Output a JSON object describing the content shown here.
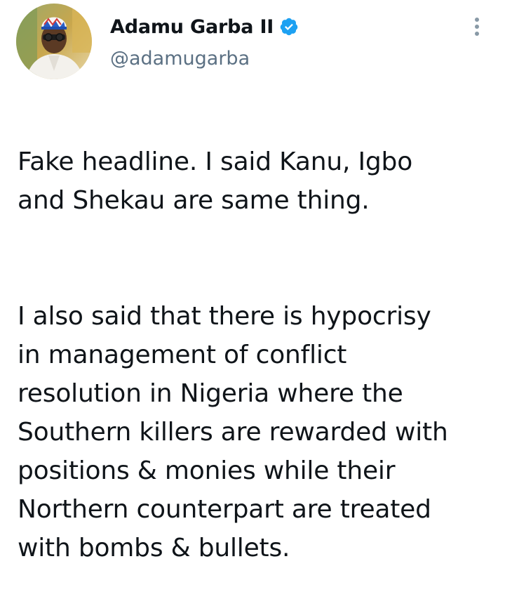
{
  "author": {
    "display_name": "Adamu Garba II",
    "handle": "@adamugarba",
    "verified_icon": "verified-badge-icon",
    "avatar_icon": "profile-avatar",
    "accent_color": "#1da1f2"
  },
  "menu": {
    "icon": "more-vertical-icon"
  },
  "tweet": {
    "paragraph1": "Fake headline. I said Kanu, Igbo\nand Shekau are same thing.",
    "paragraph2": "I also said that there is hypocrisy\nin management of conflict\nresolution in Nigeria where the\nSouthern killers are rewarded with\npositions & monies while their\nNorthern counterpart are treated\nwith bombs & bullets."
  }
}
